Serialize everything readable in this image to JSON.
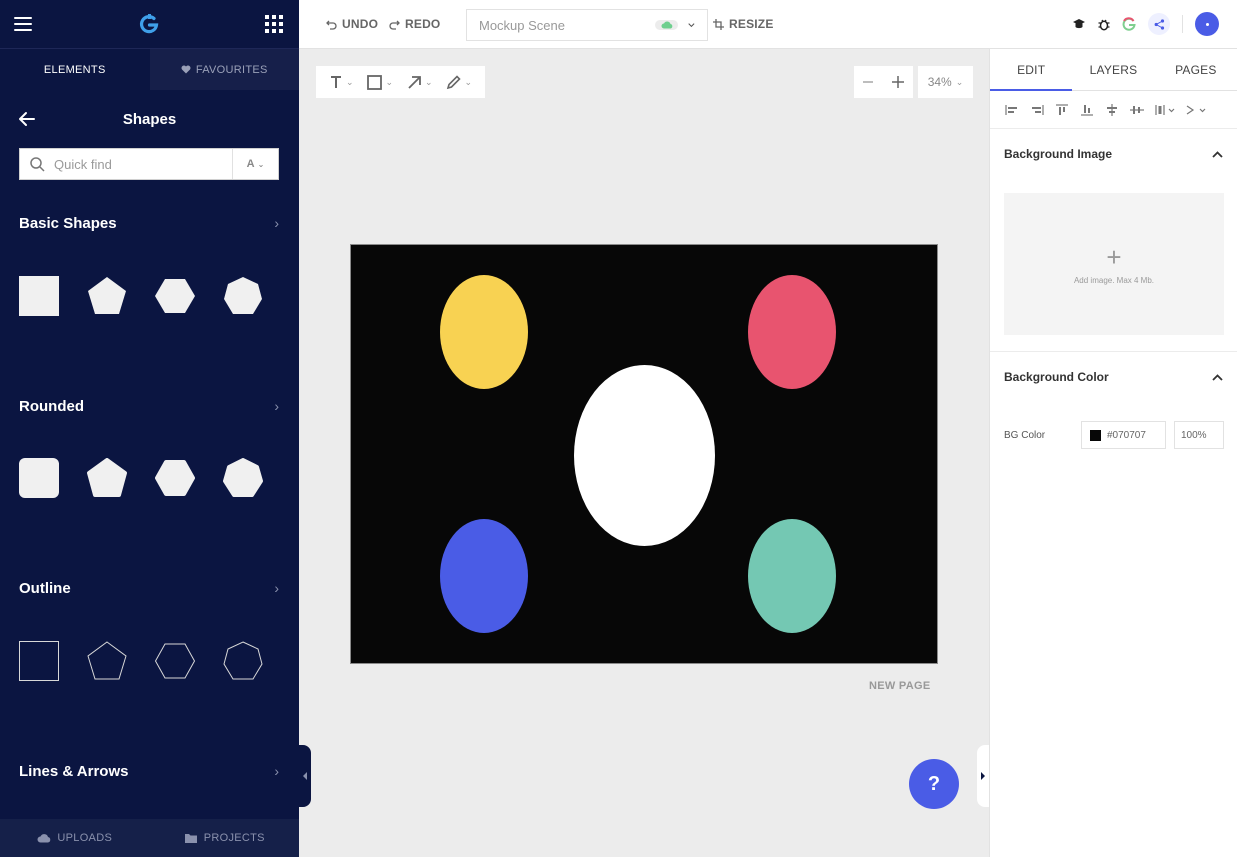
{
  "sidebar": {
    "tabs": {
      "elements": "ELEMENTS",
      "favourites": "FAVOURITES"
    },
    "panel_title": "Shapes",
    "search": {
      "placeholder": "Quick find",
      "sort_label": "A"
    },
    "sections": [
      {
        "title": "Basic Shapes"
      },
      {
        "title": "Rounded"
      },
      {
        "title": "Outline"
      },
      {
        "title": "Lines & Arrows"
      }
    ],
    "bottom": {
      "uploads": "UPLOADS",
      "projects": "PROJECTS"
    }
  },
  "toolbar": {
    "undo": "UNDO",
    "redo": "REDO",
    "scene_name": "Mockup Scene",
    "resize": "RESIZE"
  },
  "canvas": {
    "zoom": "34%",
    "new_page": "NEW PAGE",
    "background": "#070707",
    "circles": [
      {
        "name": "yellow-ellipse",
        "color": "#f8d252"
      },
      {
        "name": "red-ellipse",
        "color": "#e8546f"
      },
      {
        "name": "white-ellipse",
        "color": "#ffffff"
      },
      {
        "name": "blue-ellipse",
        "color": "#4a5ce6"
      },
      {
        "name": "teal-ellipse",
        "color": "#74c8b3"
      }
    ]
  },
  "help_label": "?",
  "right_panel": {
    "tabs": [
      "EDIT",
      "LAYERS",
      "PAGES"
    ],
    "bg_image": {
      "title": "Background Image",
      "hint": "Add image. Max 4 Mb."
    },
    "bg_color": {
      "title": "Background Color",
      "label": "BG Color",
      "value": "#070707",
      "opacity": "100%"
    }
  },
  "colors": {
    "sidebar": "#0b1541",
    "accent": "#4a5ce6"
  }
}
